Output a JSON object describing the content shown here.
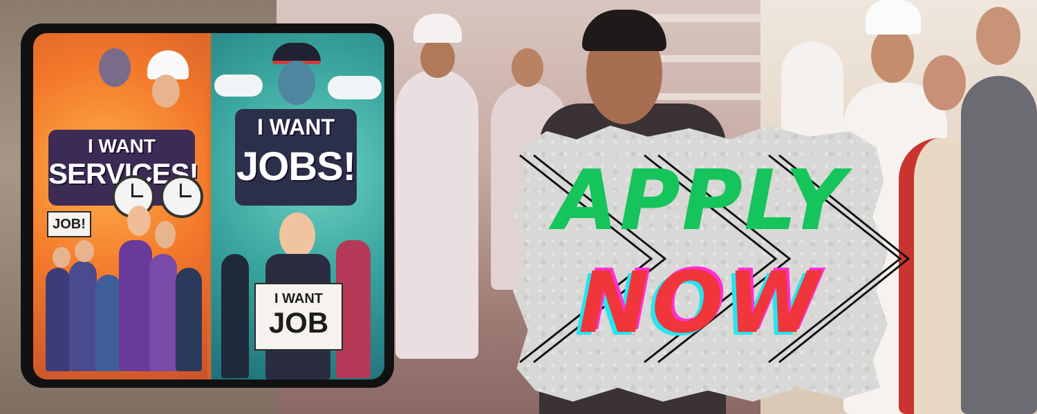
{
  "poster": {
    "left_headline_line1": "I WANT",
    "left_headline_line2": "SERVICES!",
    "left_sign": "JOB!",
    "right_headline_line1": "I WANT",
    "right_headline_line2": "JOBS!",
    "right_sign_line1": "I WANT",
    "right_sign_line2": "JOB"
  },
  "cta": {
    "line1": "APPLY",
    "line2": "NOW"
  },
  "colors": {
    "apply_green": "#15c45a",
    "now_red": "#f0363a",
    "now_magenta": "#ff2fd2",
    "now_cyan": "#22e6f0",
    "poster_orange": "#f37a2a",
    "poster_teal": "#3aa79f"
  }
}
